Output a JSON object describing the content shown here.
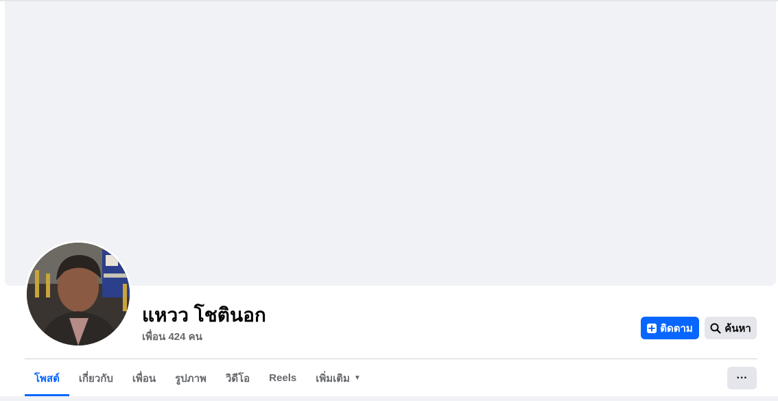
{
  "profile": {
    "name": "แหวว โชตินอก",
    "friends": "เพื่อน 424 คน"
  },
  "actions": {
    "follow_label": "ติดตาม",
    "search_label": "ค้นหา",
    "more_label": "···"
  },
  "tabs": [
    {
      "label": "โพสต์",
      "active": true
    },
    {
      "label": "เกี่ยวกับ",
      "active": false
    },
    {
      "label": "เพื่อน",
      "active": false
    },
    {
      "label": "รูปภาพ",
      "active": false
    },
    {
      "label": "วิดีโอ",
      "active": false
    },
    {
      "label": "Reels",
      "active": false
    },
    {
      "label": "เพิ่มเติม",
      "active": false
    }
  ],
  "colors": {
    "accent": "#0866ff",
    "cover_bg": "#f0f2f5",
    "secondary_text": "#65676b",
    "button_gray": "#e4e6eb"
  },
  "icons": {
    "follow": "add-friend-icon",
    "search": "search-icon",
    "more": "more-dots-icon",
    "dropdown": "caret-down-icon"
  }
}
